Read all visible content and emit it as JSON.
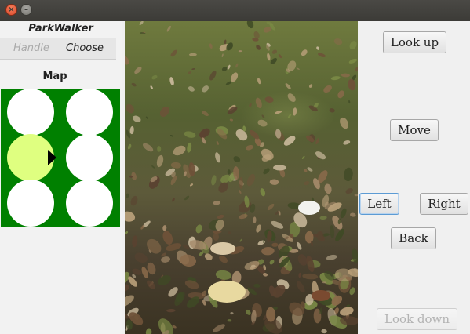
{
  "window": {
    "close_glyph": "×",
    "minimize_glyph": "–"
  },
  "sidebar": {
    "app_title": "ParkWalker",
    "tabs": [
      {
        "label": "Handle",
        "enabled": false
      },
      {
        "label": "Choose",
        "enabled": true
      }
    ],
    "map_label": "Map",
    "map": {
      "background_color": "#008000",
      "node_color": "#ffffff",
      "current_node_color": "#dfff80",
      "rows": 3,
      "cols": 2,
      "current": {
        "row": 1,
        "col": 0
      },
      "heading": "east"
    }
  },
  "photo": {
    "description_icon": "park-grass-leaves-photo"
  },
  "controls": {
    "look_up": "Look up",
    "move": "Move",
    "left": "Left",
    "right": "Right",
    "back": "Back",
    "look_down": "Look down"
  }
}
